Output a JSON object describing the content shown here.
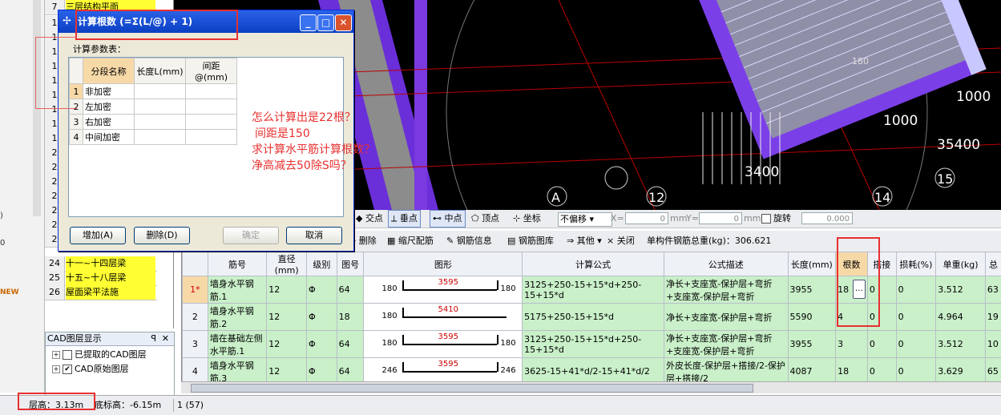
{
  "sidebar": {
    "labels": [
      ")",
      "0",
      "NEW"
    ],
    "floors": [
      {
        "num": "7",
        "name": "三层结构平面"
      },
      {
        "num": "1",
        "name": ""
      },
      {
        "num": "1",
        "name": ""
      },
      {
        "num": "1",
        "name": ""
      },
      {
        "num": "1",
        "name": ""
      },
      {
        "num": "1",
        "name": ""
      },
      {
        "num": "1",
        "name": ""
      },
      {
        "num": "1",
        "name": ""
      },
      {
        "num": "1",
        "name": ""
      },
      {
        "num": "1",
        "name": ""
      },
      {
        "num": "2",
        "name": ""
      },
      {
        "num": "2",
        "name": ""
      },
      {
        "num": "2",
        "name": ""
      },
      {
        "num": "2",
        "name": ""
      },
      {
        "num": "2",
        "name": ""
      },
      {
        "num": "2",
        "name": ""
      },
      {
        "num": "2",
        "name": ""
      },
      {
        "num": "24",
        "name": "十一~十四层梁"
      },
      {
        "num": "25",
        "name": "十五~十八层梁"
      },
      {
        "num": "26",
        "name": "屋面梁平法施"
      }
    ],
    "cad_layer": {
      "title": "CAD图层显示",
      "pin": "ꟼ",
      "close": "✕",
      "items": [
        "已提取的CAD图层",
        "CAD原始图层"
      ]
    }
  },
  "cad": {
    "labels": [
      "180",
      "1000",
      "1000",
      "35400",
      "3400",
      "15",
      "14",
      "12",
      "A"
    ]
  },
  "snap": {
    "items": [
      "交点",
      "垂点",
      "中点",
      "顶点",
      "坐标"
    ],
    "mode": "不偏移",
    "x_label": "X=",
    "x_value": "0",
    "y_label": "Y=",
    "y_value": "0",
    "unit": "mm",
    "rotate_label": "旋转",
    "rotate_value": "0.000"
  },
  "rebar_toolbar": {
    "delete": "删除",
    "scale": "缩尺配筋",
    "info": "钢筋信息",
    "library": "钢筋图库",
    "other": "其他",
    "close": "关闭",
    "total_label": "单构件钢筋总重(kg)：306.621"
  },
  "table": {
    "headers": [
      "",
      "筋号",
      "直径(mm)",
      "级别",
      "图号",
      "图形",
      "计算公式",
      "公式描述",
      "长度(mm)",
      "根数",
      "搭接",
      "损耗(%)",
      "单重(kg)",
      "总"
    ],
    "rows": [
      {
        "idx": "1*",
        "name": "墙身水平钢筋.1",
        "dia": "12",
        "grade": "Φ",
        "fig": "64",
        "left": "180",
        "mid": "3595",
        "right": "180",
        "formula": "3125+250-15+15*d+250-15+15*d",
        "desc": "净长+支座宽-保护层+弯折+支座宽-保护层+弯折",
        "len": "3955",
        "count": "18",
        "lap": "0",
        "loss": "0",
        "weight": "3.512",
        "total": "63"
      },
      {
        "idx": "2",
        "name": "墙身水平钢筋.2",
        "dia": "12",
        "grade": "Φ",
        "fig": "18",
        "left": "180",
        "mid": "5410",
        "right": "",
        "formula": "5175+250-15+15*d",
        "desc": "净长+支座宽-保护层+弯折",
        "len": "5590",
        "count": "4",
        "lap": "0",
        "loss": "0",
        "weight": "4.964",
        "total": "19"
      },
      {
        "idx": "3",
        "name": "墙在基础左侧水平筋.1",
        "dia": "12",
        "grade": "Φ",
        "fig": "64",
        "left": "180",
        "mid": "3595",
        "right": "180",
        "formula": "3125+250-15+15*d+250-15+15*d",
        "desc": "净长+支座宽-保护层+弯折+支座宽-保护层+弯折",
        "len": "3955",
        "count": "3",
        "lap": "0",
        "loss": "0",
        "weight": "3.512",
        "total": "10"
      },
      {
        "idx": "4",
        "name": "墙身水平钢筋.3",
        "dia": "12",
        "grade": "Φ",
        "fig": "64",
        "left": "246",
        "mid": "3595",
        "right": "246",
        "formula": "3625-15+41*d/2-15+41*d/2",
        "desc": "外皮长度-保护层+搭接/2-保护层+搭接/2",
        "len": "4087",
        "count": "18",
        "lap": "0",
        "loss": "0",
        "weight": "3.629",
        "total": "65"
      }
    ]
  },
  "status": {
    "floor_height": "层高：3.13m",
    "bottom_height": "底标高：-6.15m",
    "count": "1 (57)"
  },
  "dialog": {
    "title": "计算根数 (=Σ(L/@) + 1)",
    "params_label": "计算参数表：",
    "headers": [
      "分段名称",
      "长度L(mm)",
      "间距@(mm)"
    ],
    "rows": [
      {
        "num": "1",
        "name": "非加密"
      },
      {
        "num": "2",
        "name": "左加密"
      },
      {
        "num": "3",
        "name": "右加密"
      },
      {
        "num": "4",
        "name": "中间加密"
      }
    ],
    "add_button": "增加(A)",
    "delete_button": "删除(D)",
    "ok_button": "确定",
    "cancel_button": "取消"
  },
  "annotation": {
    "lines": [
      "怎么计算出是22根？",
      "间距是150",
      "求计算水平筋计算根数？",
      "净高减去50除S吗？"
    ],
    "color": "#e83030"
  }
}
